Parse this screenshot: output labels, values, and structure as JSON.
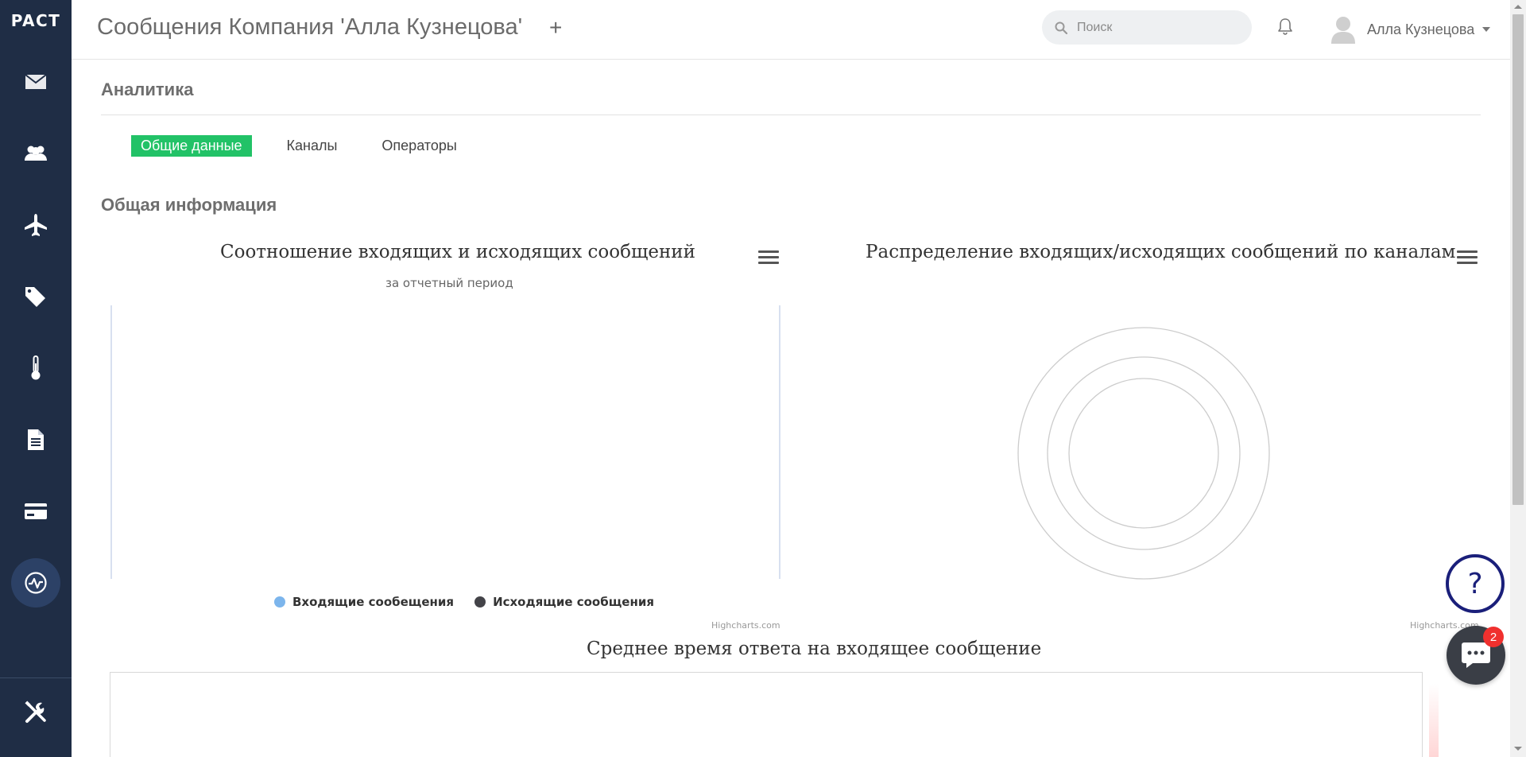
{
  "sidebar": {
    "logo": "PACT",
    "items": [
      {
        "name": "messages",
        "icon": "envelope-icon"
      },
      {
        "name": "contacts",
        "icon": "users-icon"
      },
      {
        "name": "campaigns",
        "icon": "airplane-icon"
      },
      {
        "name": "tags",
        "icon": "tags-icon"
      },
      {
        "name": "thermometer",
        "icon": "thermometer-icon"
      },
      {
        "name": "documents",
        "icon": "document-icon"
      },
      {
        "name": "billing",
        "icon": "credit-card-icon"
      },
      {
        "name": "analytics",
        "icon": "analytics-icon",
        "active": true
      }
    ],
    "settings_icon": "tools-icon"
  },
  "header": {
    "title": "Сообщения Компания 'Алла Кузнецова'",
    "add_symbol": "+",
    "search_placeholder": "Поиск",
    "user_name": "Алла Кузнецова"
  },
  "main": {
    "section_title": "Аналитика",
    "tabs": [
      {
        "label": "Общие данные",
        "active": true
      },
      {
        "label": "Каналы",
        "active": false
      },
      {
        "label": "Операторы",
        "active": false
      }
    ],
    "subsection_title": "Общая информация"
  },
  "chart_data": [
    {
      "type": "bar",
      "title": "Соотношение входящих и исходящих сообщений",
      "subtitle": "за отчетный период",
      "series": [
        {
          "name": "Входящие сообещения",
          "color": "#7cb5ec",
          "values": []
        },
        {
          "name": "Исходящие сообщения",
          "color": "#434348",
          "values": []
        }
      ],
      "credits": "Highcharts.com"
    },
    {
      "type": "pie",
      "title": "Распределение входящих/исходящих сообщений по каналам",
      "series": [],
      "credits": "Highcharts.com"
    },
    {
      "type": "line",
      "title": "Среднее время ответа на входящее сообщение",
      "series": []
    }
  ],
  "widgets": {
    "help_symbol": "?",
    "chat_badge": "2"
  },
  "colors": {
    "sidebar_bg": "#1f2d45",
    "active_tab": "#22c267",
    "help_border": "#1a1f7a",
    "badge": "#f0302e"
  }
}
